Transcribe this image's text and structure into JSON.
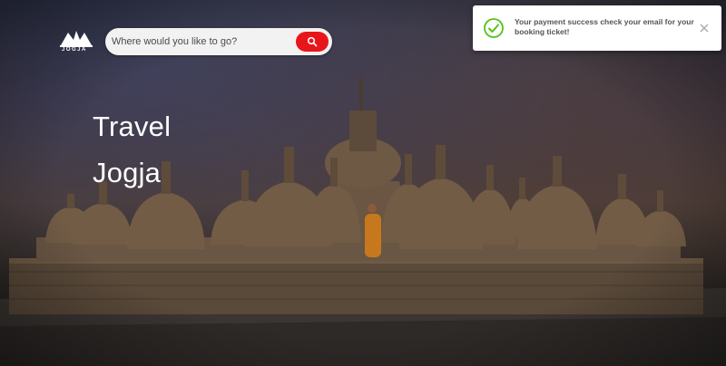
{
  "header": {
    "logo_text": "JOGJA",
    "search": {
      "placeholder": "Where would you like to go?",
      "button_icon": "search-icon"
    }
  },
  "hero": {
    "title_line1": "Travel",
    "title_line2": "Jogja"
  },
  "toast": {
    "icon": "check-circle-icon",
    "message": "Your payment success check your email for your booking ticket!",
    "close_icon": "close-icon"
  },
  "colors": {
    "accent": "#e8161b",
    "success": "#52c41a",
    "title": "#ffffff"
  }
}
